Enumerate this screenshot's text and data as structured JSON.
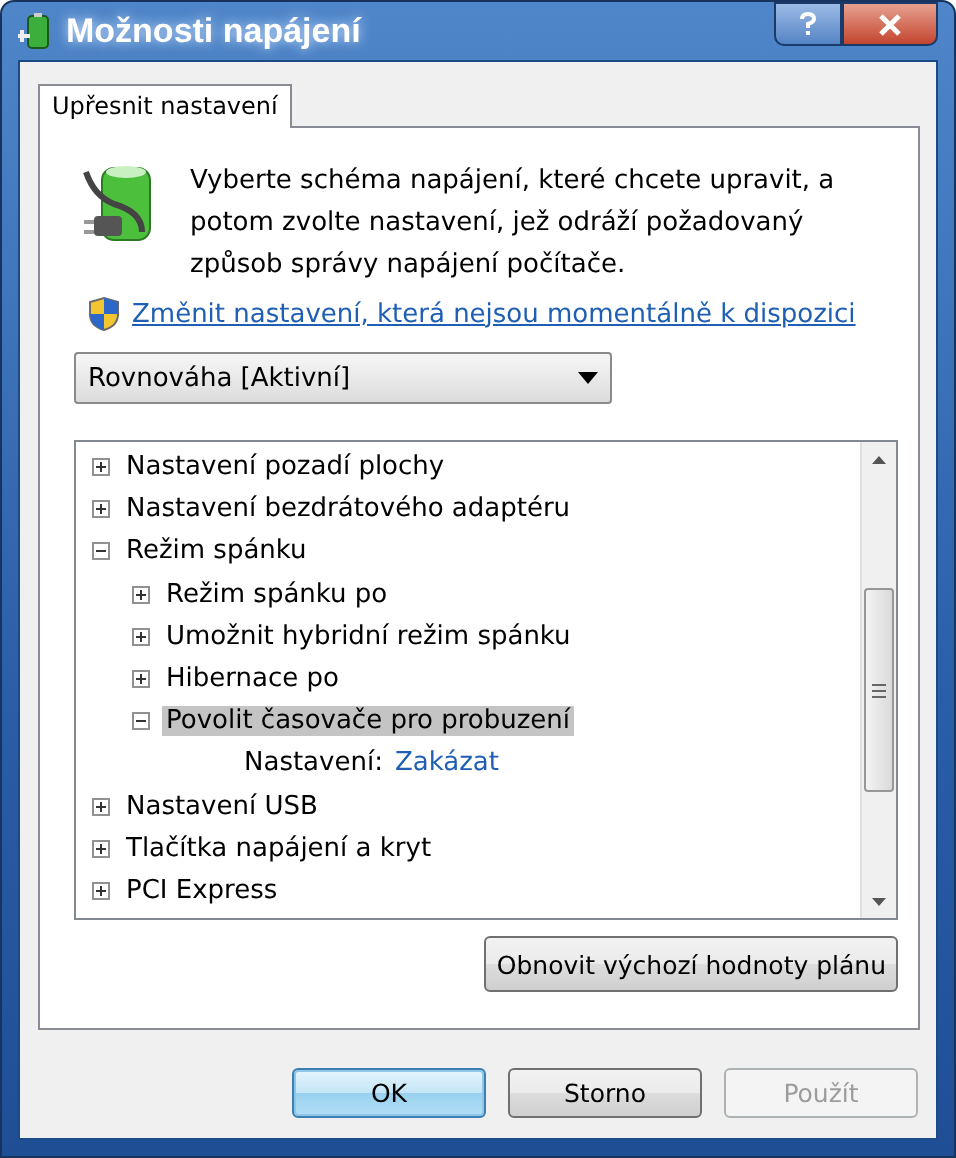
{
  "window": {
    "title": "Možnosti napájení"
  },
  "tabs": [
    {
      "label": "Upřesnit nastavení",
      "selected": true
    }
  ],
  "intro": "Vyberte schéma napájení, které chcete upravit, a potom zvolte nastavení, jež odráží požadovaný způsob správy napájení počítače.",
  "change_link": "Změnit nastavení, která nejsou momentálně k dispozici",
  "plan_dropdown": {
    "value": "Rovnováha [Aktivní]"
  },
  "tree": [
    {
      "kind": "group",
      "label": "Nastavení pozadí plochy",
      "expanded": false,
      "selected": false
    },
    {
      "kind": "group",
      "label": "Nastavení bezdrátového adaptéru",
      "expanded": false,
      "selected": false
    },
    {
      "kind": "group",
      "label": "Režim spánku",
      "expanded": true,
      "selected": false,
      "children": [
        {
          "kind": "group",
          "label": "Režim spánku po",
          "expanded": false,
          "selected": false
        },
        {
          "kind": "group",
          "label": "Umožnit hybridní režim spánku",
          "expanded": false,
          "selected": false
        },
        {
          "kind": "group",
          "label": "Hibernace po",
          "expanded": false,
          "selected": false
        },
        {
          "kind": "group",
          "label": "Povolit časovače pro probuzení",
          "expanded": true,
          "selected": true,
          "children": [
            {
              "kind": "setting",
              "label": "Nastavení:",
              "value": "Zakázat"
            }
          ]
        }
      ]
    },
    {
      "kind": "group",
      "label": "Nastavení USB",
      "expanded": false,
      "selected": false
    },
    {
      "kind": "group",
      "label": "Tlačítka napájení a kryt",
      "expanded": false,
      "selected": false
    },
    {
      "kind": "group",
      "label": "PCI Express",
      "expanded": false,
      "selected": false
    }
  ],
  "restore_button": "Obnovit výchozí hodnoty plánu",
  "buttons": [
    {
      "label": "OK",
      "default": true,
      "disabled": false
    },
    {
      "label": "Storno",
      "default": false,
      "disabled": false
    },
    {
      "label": "Použít",
      "default": false,
      "disabled": true
    }
  ]
}
